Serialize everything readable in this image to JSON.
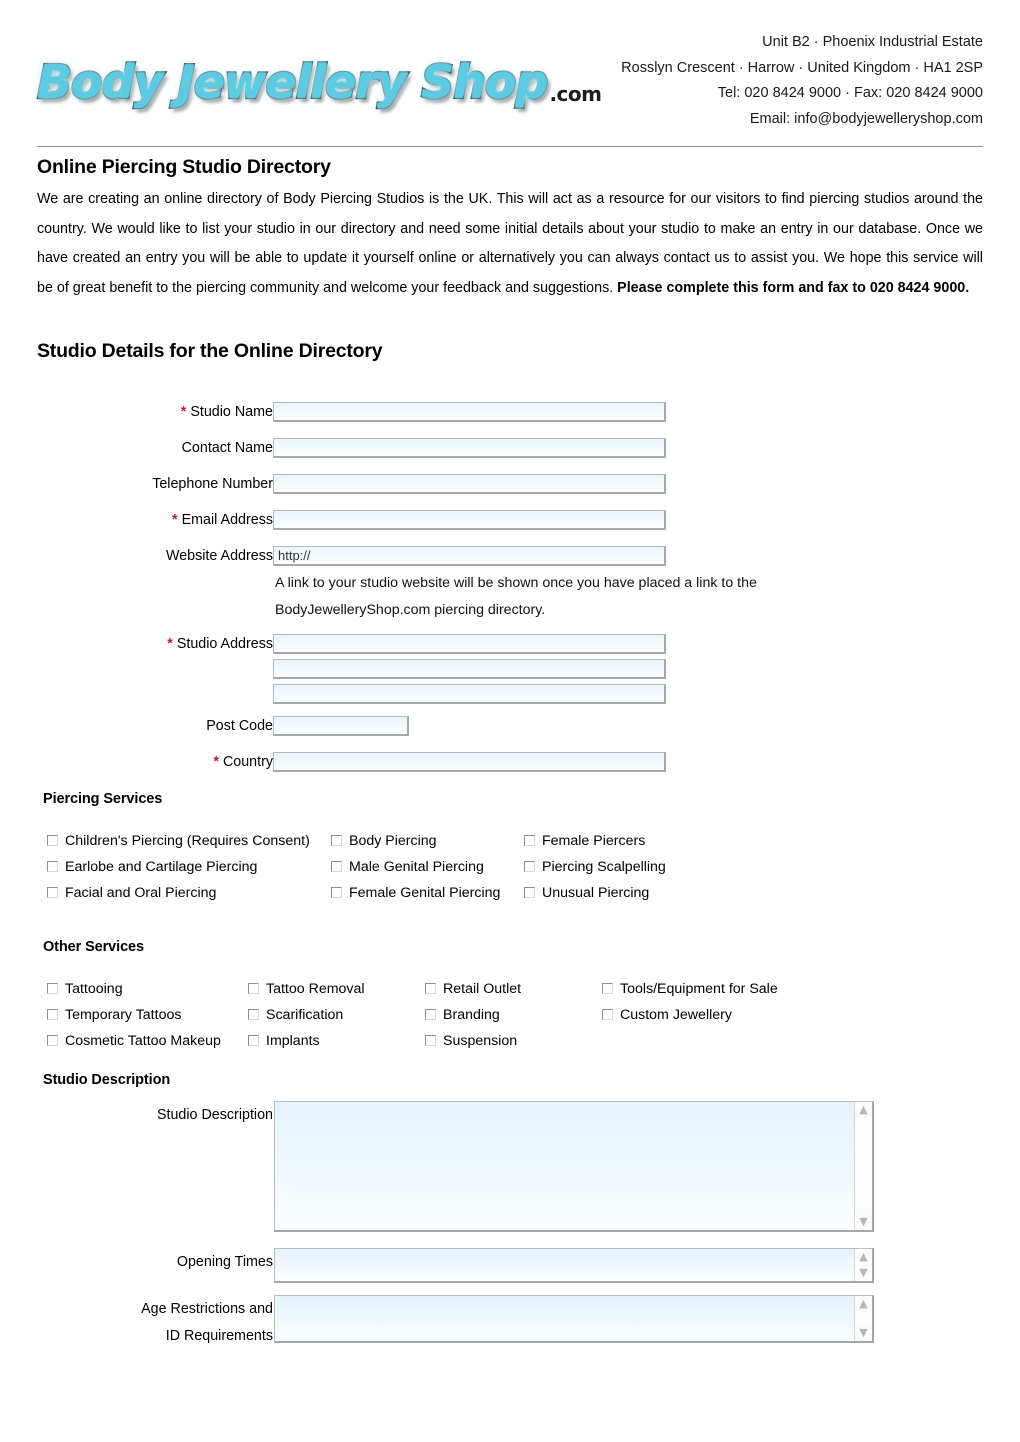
{
  "company": {
    "logo_text": "Body Jewellery Shop",
    "logo_tld": ".com",
    "address_lines": [
      "Unit B2 · Phoenix Industrial Estate",
      "Rosslyn Crescent · Harrow · United Kingdom · HA1 2SP",
      "Tel: 020 8424 9000 · Fax: 020 8424 9000",
      "Email: info@bodyjewelleryshop.com"
    ]
  },
  "intro": {
    "title": "Online Piercing Studio Directory",
    "body": "We are creating an online directory of Body Piercing Studios is the UK. This will act as a resource for our visitors to find piercing studios around the country. We would like to list your studio in our directory and need some initial details about your studio to make an entry in our database. Once we have created an entry you will be able to update it yourself online or alternatively you can always contact us to assist you. We hope this service will be of great benefit to the piercing community and welcome your feedback and suggestions. ",
    "body_bold": "Please complete this form and fax to 020 8424 9000."
  },
  "studio_details": {
    "heading": "Studio Details for the Online Directory",
    "fields": [
      {
        "label": "Studio Name",
        "required": true,
        "value": "",
        "placeholder": ""
      },
      {
        "label": "Contact Name",
        "required": false,
        "value": "",
        "placeholder": ""
      },
      {
        "label": "Telephone Number",
        "required": false,
        "value": "",
        "placeholder": ""
      },
      {
        "label": "Email Address",
        "required": true,
        "value": "",
        "placeholder": ""
      },
      {
        "label": "Website Address",
        "required": false,
        "value": "http://",
        "placeholder": "http://"
      },
      {
        "label": "Studio Address",
        "required": true,
        "value": "",
        "placeholder": ""
      },
      {
        "label": "Post Code",
        "required": false,
        "value": "",
        "placeholder": ""
      },
      {
        "label": "Country",
        "required": true,
        "value": "",
        "placeholder": ""
      }
    ],
    "website_hint_line1": "A link to your studio website will be shown once you have placed a link to the",
    "website_hint_line2": "BodyJewelleryShop.com piercing directory.",
    "required_marker": "*"
  },
  "piercing_services": {
    "heading": "Piercing Services",
    "columns": [
      [
        "Children's Piercing (Requires Consent)",
        "Earlobe and Cartilage Piercing",
        "Facial and Oral Piercing"
      ],
      [
        "Body Piercing",
        "Male Genital Piercing",
        "Female Genital Piercing"
      ],
      [
        "Female Piercers",
        "Piercing Scalpelling",
        "Unusual Piercing"
      ]
    ]
  },
  "other_services": {
    "heading": "Other Services",
    "columns": [
      [
        "Tattooing",
        "Temporary Tattoos",
        "Cosmetic Tattoo Makeup"
      ],
      [
        "Tattoo Removal",
        "Scarification",
        "Implants"
      ],
      [
        "Retail Outlet",
        "Branding",
        "Suspension"
      ],
      [
        "Tools/Equipment for Sale",
        "Custom Jewellery"
      ]
    ]
  },
  "studio_description": {
    "heading": "Studio Description",
    "areas": [
      {
        "label": "Studio Description",
        "label2": "",
        "value": ""
      },
      {
        "label": "Opening Times",
        "label2": "",
        "value": ""
      },
      {
        "label": "Age Restrictions and",
        "label2": "ID Requirements",
        "value": ""
      }
    ],
    "scroll_up_icon": "scroll-up-arrow",
    "scroll_down_icon": "scroll-down-arrow"
  },
  "colors": {
    "logo_cyan": "#5BCBE3",
    "required_red": "#bb2222",
    "field_fill_top": "#e8f4fb",
    "field_border": "#9a9a9a",
    "rule": "#8e8e8e"
  }
}
